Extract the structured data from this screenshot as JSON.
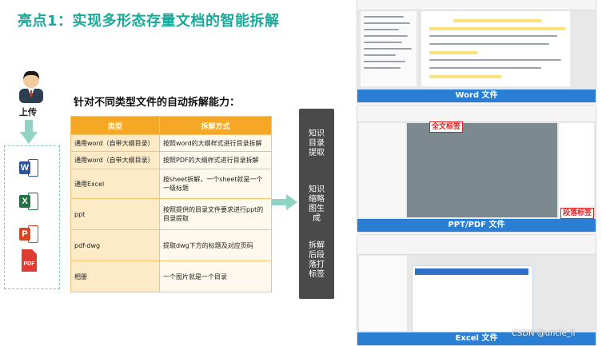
{
  "title": "亮点1：实现多形态存量文档的智能拆解",
  "upload_label": "上传",
  "subtitle": "针对不同类型文件的自动拆解能力：",
  "table": {
    "headers": [
      "类型",
      "拆解方式"
    ],
    "rows": [
      [
        "通用word（自带大纲目录）",
        "按照word的大纲样式进行目录拆解"
      ],
      [
        "通用word（自带大纲目录）",
        "按照PDF的大纲样式进行目录拆解"
      ],
      [
        "通用Excel",
        "按sheet拆解，一个sheet就是一个一级标题"
      ],
      [
        "ppt",
        "按照提供的目录文件要求进行ppt的目录提取"
      ],
      [
        "pdf-dwg",
        "提取dwg下方的标题及对应页码"
      ],
      [
        "相册",
        "一个图片就是一个目录"
      ]
    ]
  },
  "process_steps": [
    "知识目录提取",
    "知识缩略图生成",
    "拆解后段落打标签"
  ],
  "file_icons": [
    "word-icon",
    "excel-icon",
    "powerpoint-icon",
    "pdf-icon"
  ],
  "screenshots": {
    "word": {
      "caption": "Word 文件"
    },
    "ppt_pdf": {
      "caption": "PPT/PDF 文件",
      "tag_full": "全文标签",
      "tag_para": "段落标签"
    },
    "excel": {
      "caption": "Excel 文件"
    }
  },
  "watermark": "CSDN @uncle_ll",
  "colors": {
    "title": "#19a89a",
    "table_header": "#f4a825",
    "caption_bar": "#2a7fd4",
    "process_box": "#4a4a4a"
  }
}
